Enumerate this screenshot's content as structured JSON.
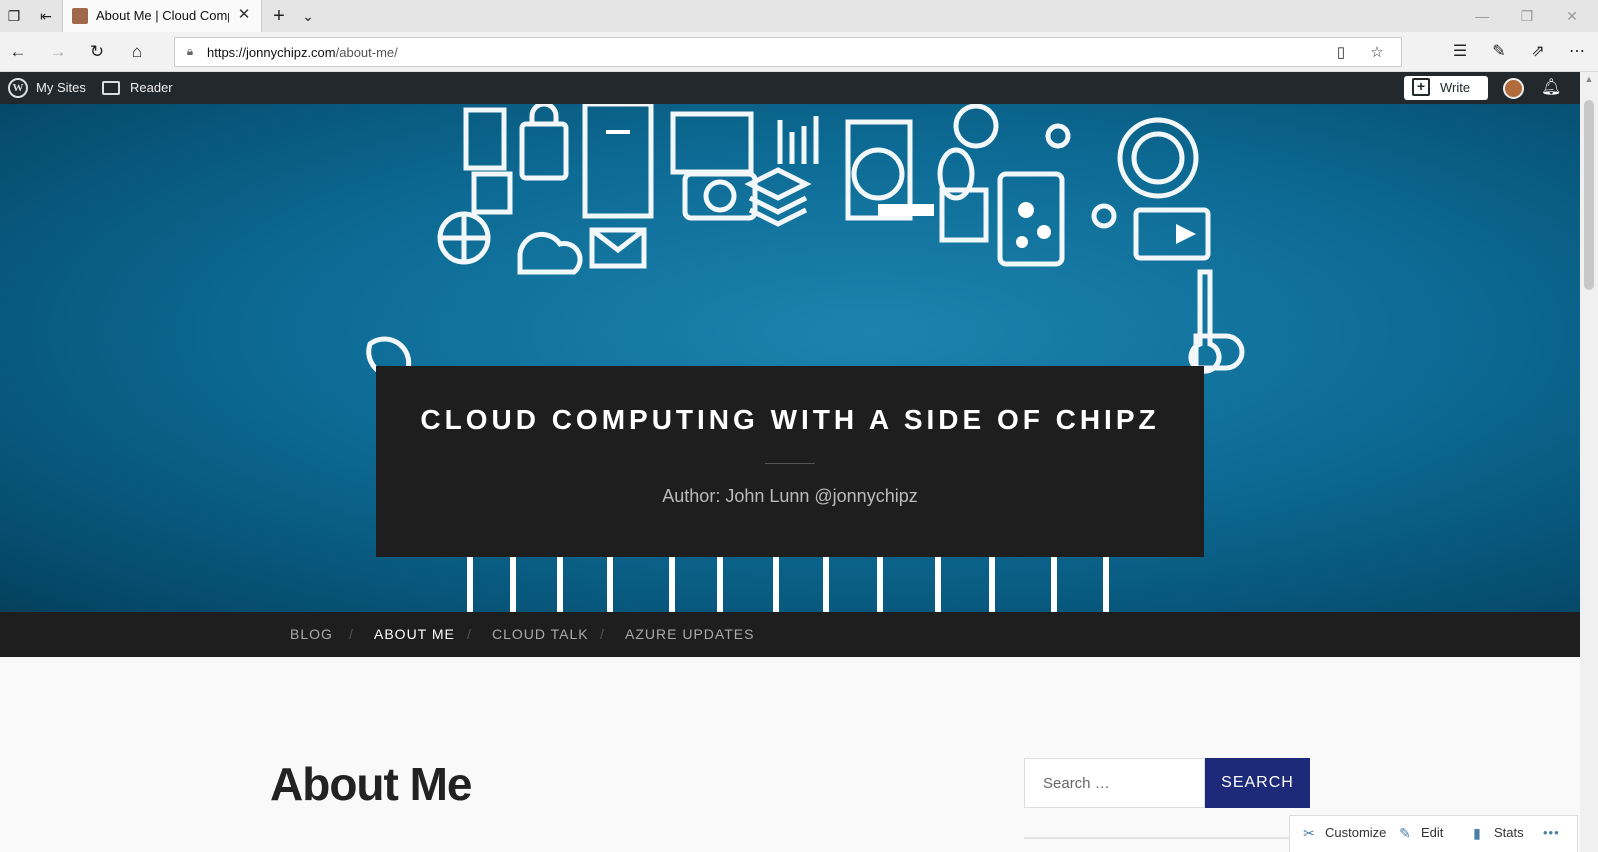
{
  "browser": {
    "tab_title": "About Me | Cloud Computing with a side of Chipz",
    "url_domain": "https://jonnychipz.com",
    "url_path": "/about-me/",
    "icons": [
      "tab-manager-icon",
      "set-aside-icon",
      "new-tab-icon",
      "tab-list-icon",
      "back-icon",
      "forward-icon",
      "refresh-icon",
      "home-icon",
      "lock-icon",
      "reading-view-icon",
      "favorite-star-icon",
      "favorites-hub-icon",
      "pen-icon",
      "share-icon",
      "more-icon"
    ]
  },
  "admin_bar": {
    "my_sites": "My Sites",
    "reader": "Reader",
    "write": "Write"
  },
  "header": {
    "site_title": "CLOUD COMPUTING WITH A SIDE OF CHIPZ",
    "site_description": "Author: John Lunn @jonnychipz"
  },
  "menu": {
    "items": [
      {
        "label": "BLOG",
        "current": false
      },
      {
        "label": "ABOUT ME",
        "current": true
      },
      {
        "label": "CLOUD TALK",
        "current": false
      },
      {
        "label": "AZURE UPDATES",
        "current": false
      }
    ],
    "separator": "/"
  },
  "content": {
    "page_title": "About Me"
  },
  "search": {
    "placeholder": "Search …",
    "button_label": "SEARCH"
  },
  "actions": {
    "customize": "Customize",
    "edit": "Edit",
    "stats": "Stats",
    "more": "•••"
  },
  "colors": {
    "hero_blue": "#0d6c96",
    "dark_bar": "#1e1e1e",
    "admin_bar": "#23282d",
    "search_button": "#1d2a7a"
  }
}
